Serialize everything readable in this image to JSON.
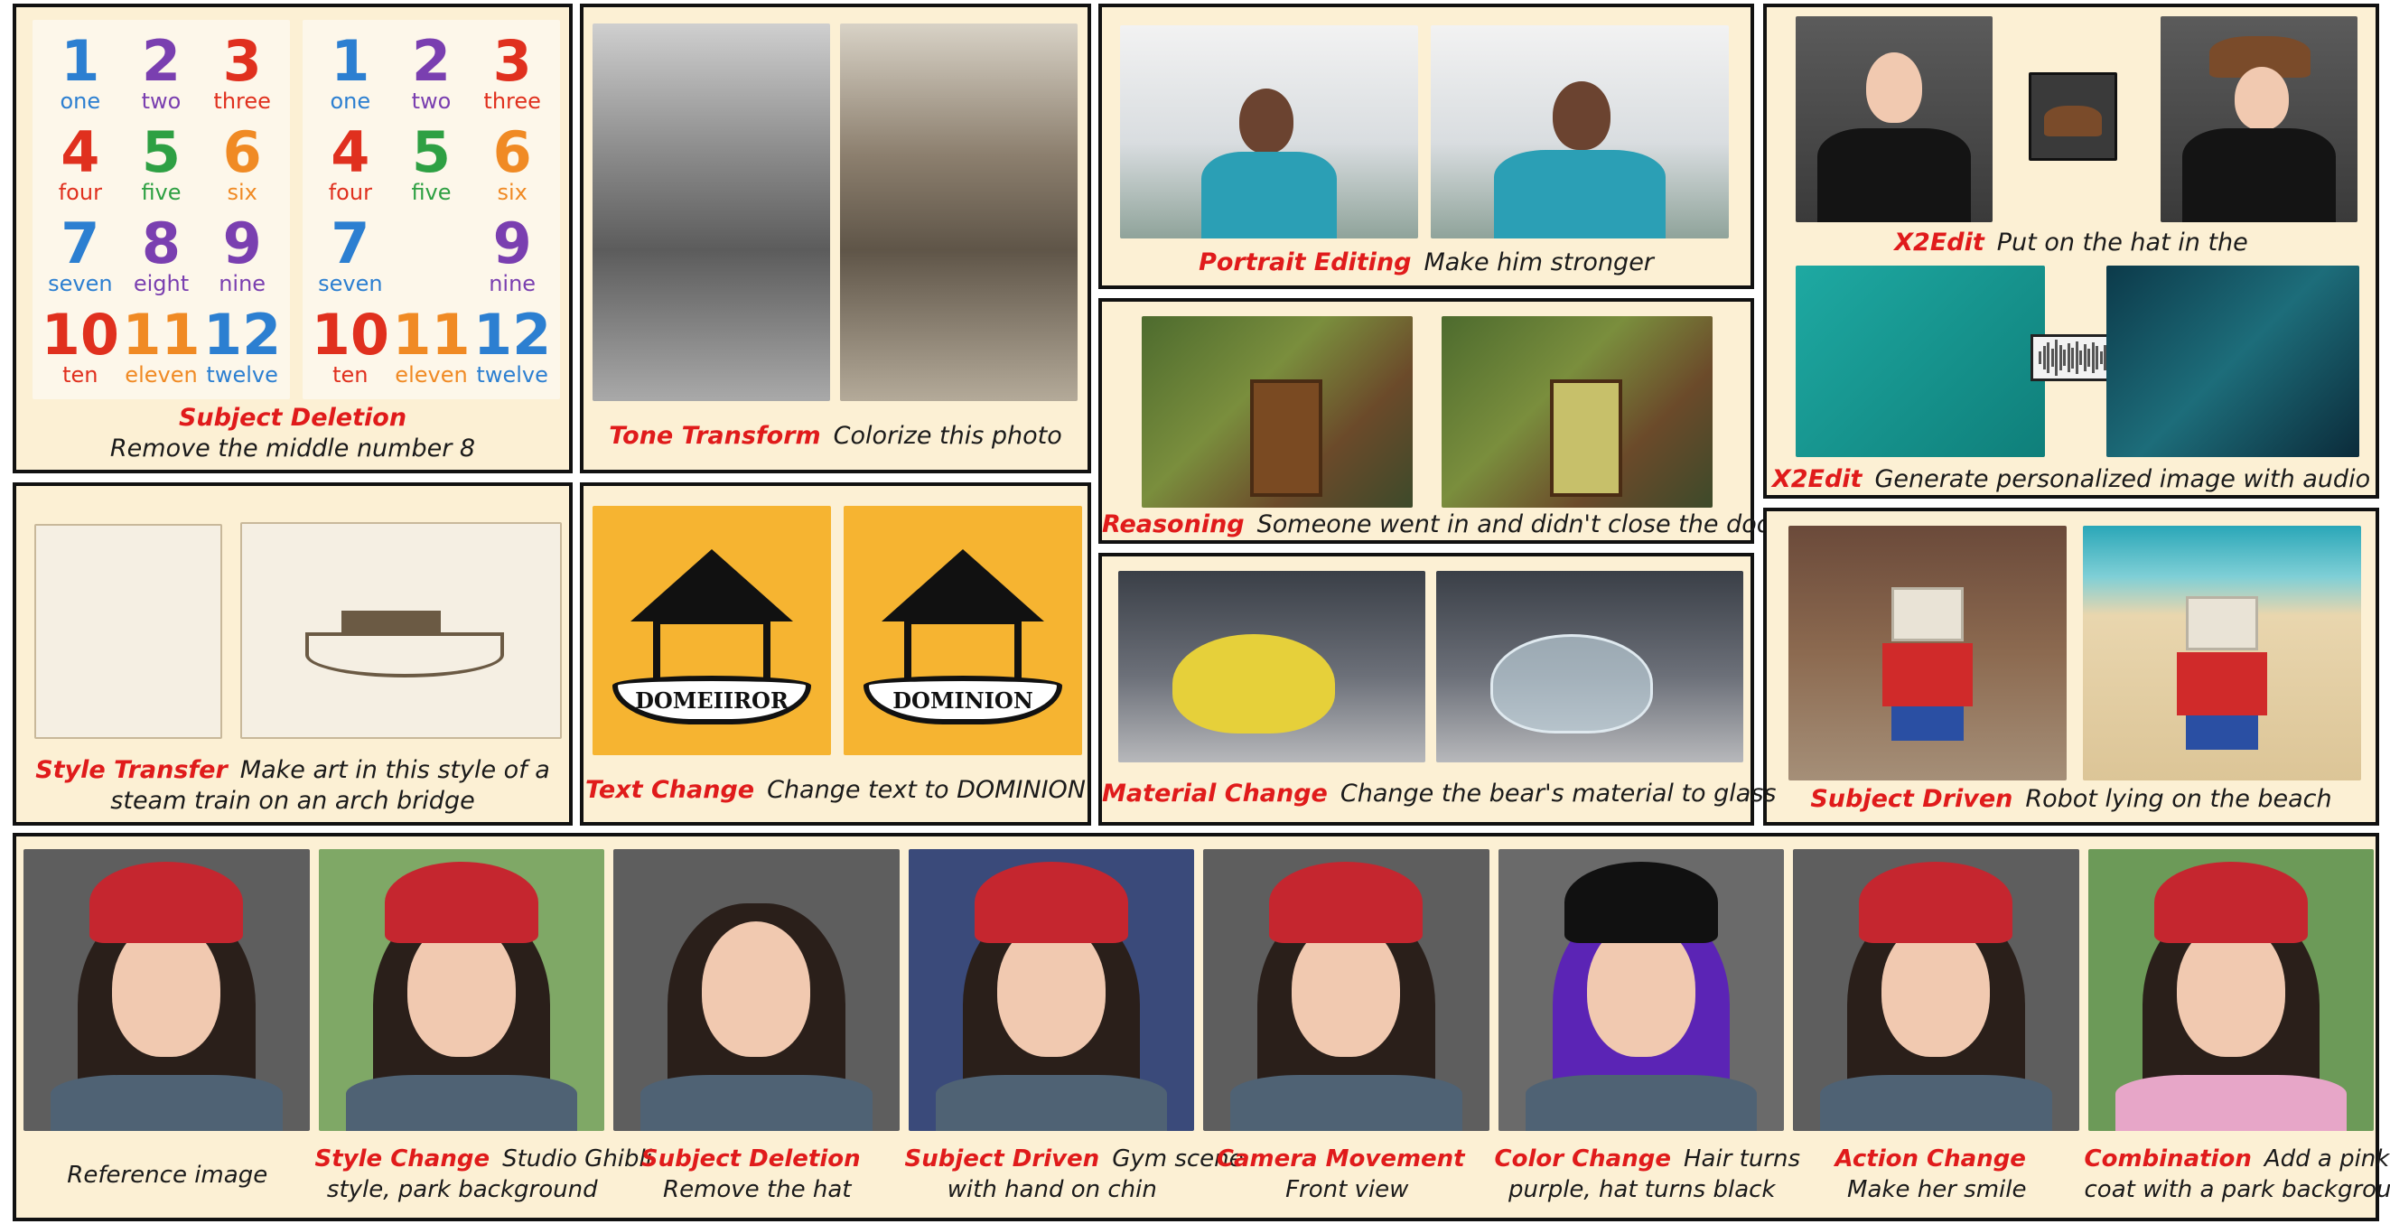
{
  "panels": {
    "subject_deletion_numbers": {
      "tag": "Subject Deletion",
      "caption": "Remove the middle number 8",
      "numbers": [
        {
          "n": "1",
          "w": "one",
          "c": "#2c7fd1"
        },
        {
          "n": "2",
          "w": "two",
          "c": "#7a3fb0"
        },
        {
          "n": "3",
          "w": "three",
          "c": "#e0301e"
        },
        {
          "n": "4",
          "w": "four",
          "c": "#e0301e"
        },
        {
          "n": "5",
          "w": "five",
          "c": "#2ea043"
        },
        {
          "n": "6",
          "w": "six",
          "c": "#f08a24"
        },
        {
          "n": "7",
          "w": "seven",
          "c": "#2c7fd1"
        },
        {
          "n": "8",
          "w": "eight",
          "c": "#7a3fb0"
        },
        {
          "n": "9",
          "w": "nine",
          "c": "#7a3fb0"
        },
        {
          "n": "10",
          "w": "ten",
          "c": "#e0301e"
        },
        {
          "n": "11",
          "w": "eleven",
          "c": "#f08a24"
        },
        {
          "n": "12",
          "w": "twelve",
          "c": "#2c7fd1"
        }
      ]
    },
    "tone_transform": {
      "tag": "Tone Transform",
      "caption": "Colorize this photo"
    },
    "portrait_editing": {
      "tag": "Portrait Editing",
      "caption": "Make him stronger"
    },
    "reasoning": {
      "tag": "Reasoning",
      "caption": "Someone went in and didn't close the door"
    },
    "material_change": {
      "tag": "Material Change",
      "caption": "Change the bear's material to glass"
    },
    "x2edit_hat": {
      "tag": "X2Edit",
      "caption": "Put on the hat in the"
    },
    "x2edit_audio": {
      "tag": "X2Edit",
      "caption": "Generate personalized image with audio"
    },
    "style_transfer": {
      "tag": "Style Transfer",
      "caption_line1": "Make art in this style of a",
      "caption_line2": "steam train on an arch bridge"
    },
    "text_change": {
      "tag": "Text Change",
      "caption": "Change text to DOMINION",
      "logo_before": "DOMEIIROR",
      "logo_after": "DOMINION"
    },
    "subject_driven_robot": {
      "tag": "Subject Driven",
      "caption": "Robot lying on the beach"
    }
  },
  "bottom_row": [
    {
      "tag": "",
      "line1": "Reference image",
      "line2": ""
    },
    {
      "tag": "Style Change",
      "line1": "Studio Ghibli",
      "line2": "style, park background"
    },
    {
      "tag": "Subject Deletion",
      "line1": "",
      "line2": "Remove the hat"
    },
    {
      "tag": "Subject Driven",
      "line1": "Gym scene",
      "line2": "with hand on chin"
    },
    {
      "tag": "Camera Movement",
      "line1": "",
      "line2": "Front view"
    },
    {
      "tag": "Color Change",
      "line1": "Hair turns",
      "line2": "purple, hat turns black"
    },
    {
      "tag": "Action Change",
      "line1": "",
      "line2": "Make her smile"
    },
    {
      "tag": "Combination",
      "line1": "Add a pink",
      "line2": "coat with a park background"
    }
  ],
  "colors": {
    "panel_bg": "#fcf0d4",
    "tag_red": "#e01b1b",
    "border": "#111111"
  }
}
